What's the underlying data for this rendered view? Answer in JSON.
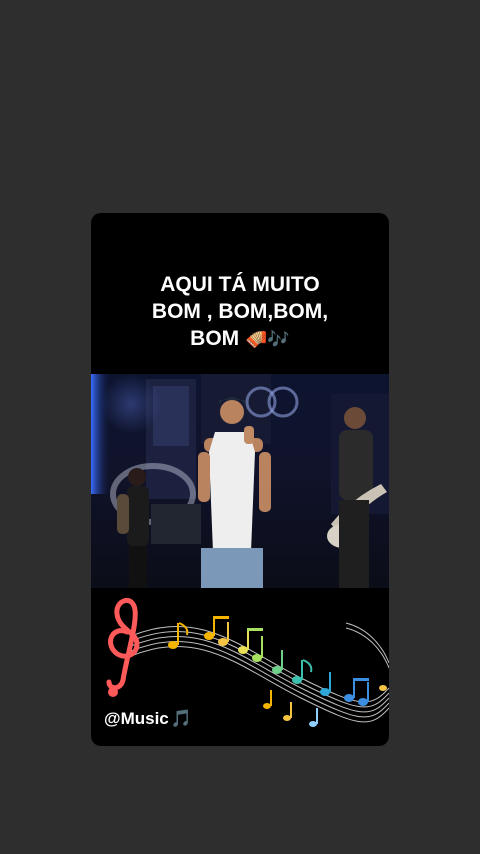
{
  "story": {
    "caption_lines": [
      "AQUI TÁ MUITO",
      "BOM , BOM,BOM,",
      "BOM"
    ],
    "caption_emojis": [
      "🪗",
      "🎶"
    ],
    "music_tag": "@Music",
    "music_tag_emoji": "🎵"
  },
  "icons": {
    "accordion": "accordion-emoji",
    "notes": "musical-notes-emoji",
    "treble_clef": "treble-clef-sticker",
    "music_note": "music-note-emoji"
  }
}
